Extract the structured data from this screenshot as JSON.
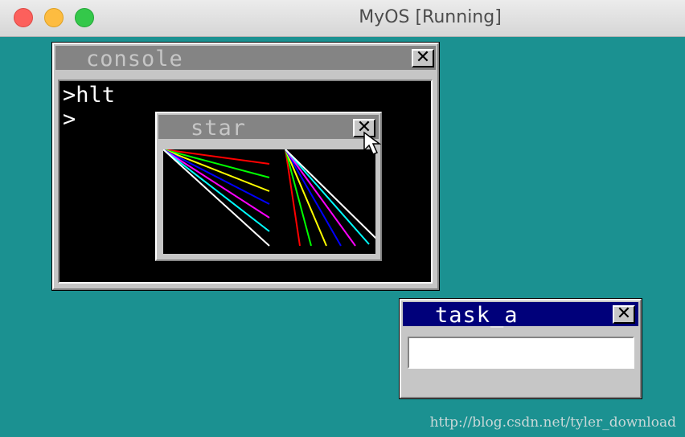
{
  "host_window": {
    "title": "MyOS [Running]"
  },
  "console_window": {
    "title": "console",
    "close_label": "✕",
    "lines": [
      ">hlt",
      ">"
    ]
  },
  "star_window": {
    "title": "star",
    "close_label": "✕",
    "line_colors": [
      "#ff0000",
      "#00ff00",
      "#ffff00",
      "#0000ff",
      "#ff00ff",
      "#00ffff",
      "#ffffff"
    ]
  },
  "task_a_window": {
    "title": "task_a",
    "close_label": "✕",
    "input_value": ""
  },
  "watermark": "http://blog.csdn.net/tyler_download",
  "colors": {
    "desktop": "#1b9191",
    "active_title": "#00007a",
    "inactive_title": "#848484"
  }
}
